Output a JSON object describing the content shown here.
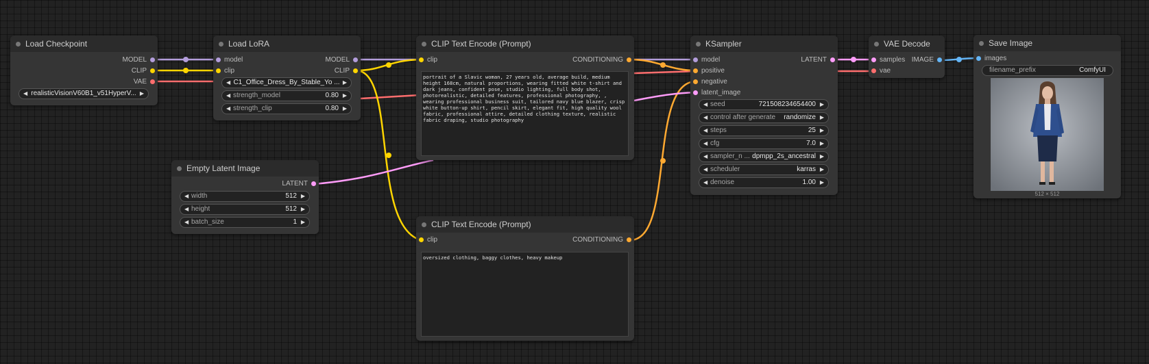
{
  "colors": {
    "model": "#b39ddb",
    "clip": "#ffd500",
    "vae": "#ff6e6e",
    "conditioning": "#ffa931",
    "latent": "#ff9cf9",
    "image": "#64b5f6",
    "background": "#222222"
  },
  "nodes": {
    "load_checkpoint": {
      "title": "Load Checkpoint",
      "outputs": [
        "MODEL",
        "CLIP",
        "VAE"
      ],
      "ckpt_name": "realisticVisionV60B1_v51HyperV..."
    },
    "load_lora": {
      "title": "Load LoRA",
      "inputs": [
        "model",
        "clip"
      ],
      "outputs": [
        "MODEL",
        "CLIP"
      ],
      "lora_name": "C1_Office_Dress_By_Stable_Yo ...",
      "strength_model": {
        "label": "strength_model",
        "value": "0.80"
      },
      "strength_clip": {
        "label": "strength_clip",
        "value": "0.80"
      }
    },
    "clip_positive": {
      "title": "CLIP Text Encode (Prompt)",
      "input": "clip",
      "output": "CONDITIONING",
      "text": "portrait of a Slavic woman, 27 years old, average build, medium\nheight 168cm, natural proportions, wearing fitted white t-shirt and\ndark jeans, confident pose, studio lighting, full body shot,\nphotorealistic, detailed features, professional photography, ,\nwearing professional business suit, tailored navy blue blazer, crisp\nwhite button-up shirt, pencil skirt, elegant fit, high quality wool\nfabric, professional attire, detailed clothing texture, realistic\nfabric draping, studio photography"
    },
    "clip_negative": {
      "title": "CLIP Text Encode (Prompt)",
      "input": "clip",
      "output": "CONDITIONING",
      "text": "oversized clothing, baggy clothes, heavy makeup"
    },
    "empty_latent": {
      "title": "Empty Latent Image",
      "output": "LATENT",
      "width": {
        "label": "width",
        "value": "512"
      },
      "height": {
        "label": "height",
        "value": "512"
      },
      "batch_size": {
        "label": "batch_size",
        "value": "1"
      }
    },
    "ksampler": {
      "title": "KSampler",
      "inputs": [
        "model",
        "positive",
        "negative",
        "latent_image"
      ],
      "output": "LATENT",
      "seed": {
        "label": "seed",
        "value": "721508234654400"
      },
      "control_after_generate": {
        "label": "control after generate",
        "value": "randomize"
      },
      "steps": {
        "label": "steps",
        "value": "25"
      },
      "cfg": {
        "label": "cfg",
        "value": "7.0"
      },
      "sampler_name": {
        "label": "sampler_n ...",
        "value": "dpmpp_2s_ancestral"
      },
      "scheduler": {
        "label": "scheduler",
        "value": "karras"
      },
      "denoise": {
        "label": "denoise",
        "value": "1.00"
      }
    },
    "vae_decode": {
      "title": "VAE Decode",
      "inputs": [
        "samples",
        "vae"
      ],
      "output": "IMAGE"
    },
    "save_image": {
      "title": "Save Image",
      "input": "images",
      "filename_prefix": {
        "label": "filename_prefix",
        "value": "ComfyUI"
      },
      "image_caption": "512 × 512"
    }
  }
}
